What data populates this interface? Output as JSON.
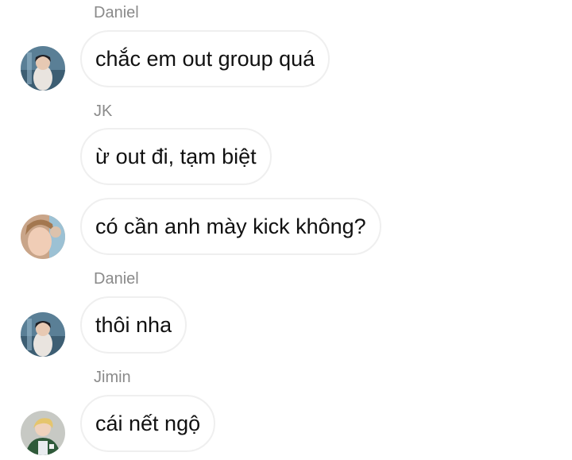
{
  "messages": [
    {
      "sender": "Daniel",
      "text": "chắc em out group quá",
      "avatar": "daniel-avatar"
    },
    {
      "sender": "JK",
      "text": "ừ out đi, tạm biệt",
      "avatar": ""
    },
    {
      "sender": "",
      "text": "có cần anh mày kick không?",
      "avatar": "jk-avatar"
    },
    {
      "sender": "Daniel",
      "text": "thôi nha",
      "avatar": "daniel-avatar"
    },
    {
      "sender": "Jimin",
      "text": "cái nết ngộ",
      "avatar": "jimin-avatar"
    }
  ],
  "colors": {
    "sender_name": "#8a8a8a",
    "bubble_border": "#efefef",
    "message_text": "#111111",
    "background": "#ffffff"
  }
}
